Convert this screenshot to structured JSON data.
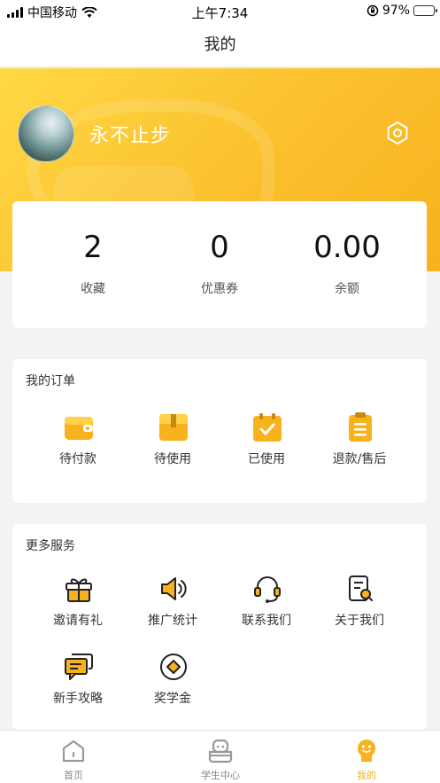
{
  "status_bar": {
    "carrier": "中国移动",
    "time": "上午7:34",
    "battery": "97%"
  },
  "nav": {
    "title": "我的"
  },
  "profile": {
    "username": "永不止步",
    "settings_icon": "settings-hexagon-icon"
  },
  "stats": [
    {
      "value": "2",
      "label": "收藏"
    },
    {
      "value": "0",
      "label": "优惠券"
    },
    {
      "value": "0.00",
      "label": "余额"
    }
  ],
  "orders": {
    "title": "我的订单",
    "items": [
      {
        "label": "待付款",
        "icon": "wallet-icon"
      },
      {
        "label": "待使用",
        "icon": "box-icon"
      },
      {
        "label": "已使用",
        "icon": "checked-clipboard-icon"
      },
      {
        "label": "退款/售后",
        "icon": "refund-clipboard-icon"
      }
    ]
  },
  "services": {
    "title": "更多服务",
    "items": [
      {
        "label": "邀请有礼",
        "icon": "gift-icon"
      },
      {
        "label": "推广统计",
        "icon": "speaker-icon"
      },
      {
        "label": "联系我们",
        "icon": "headset-icon"
      },
      {
        "label": "关于我们",
        "icon": "document-search-icon"
      },
      {
        "label": "新手攻略",
        "icon": "chat-bubbles-icon"
      },
      {
        "label": "奖学金",
        "icon": "coin-icon"
      }
    ]
  },
  "tabbar": {
    "items": [
      {
        "label": "首页",
        "icon": "home-icon"
      },
      {
        "label": "学生中心",
        "icon": "student-center-icon"
      },
      {
        "label": "我的",
        "icon": "mine-icon"
      }
    ],
    "active_index": 2
  },
  "colors": {
    "accent": "#fbc02d",
    "accent_light": "#ffd845",
    "tab_active": "#f2b01e"
  }
}
